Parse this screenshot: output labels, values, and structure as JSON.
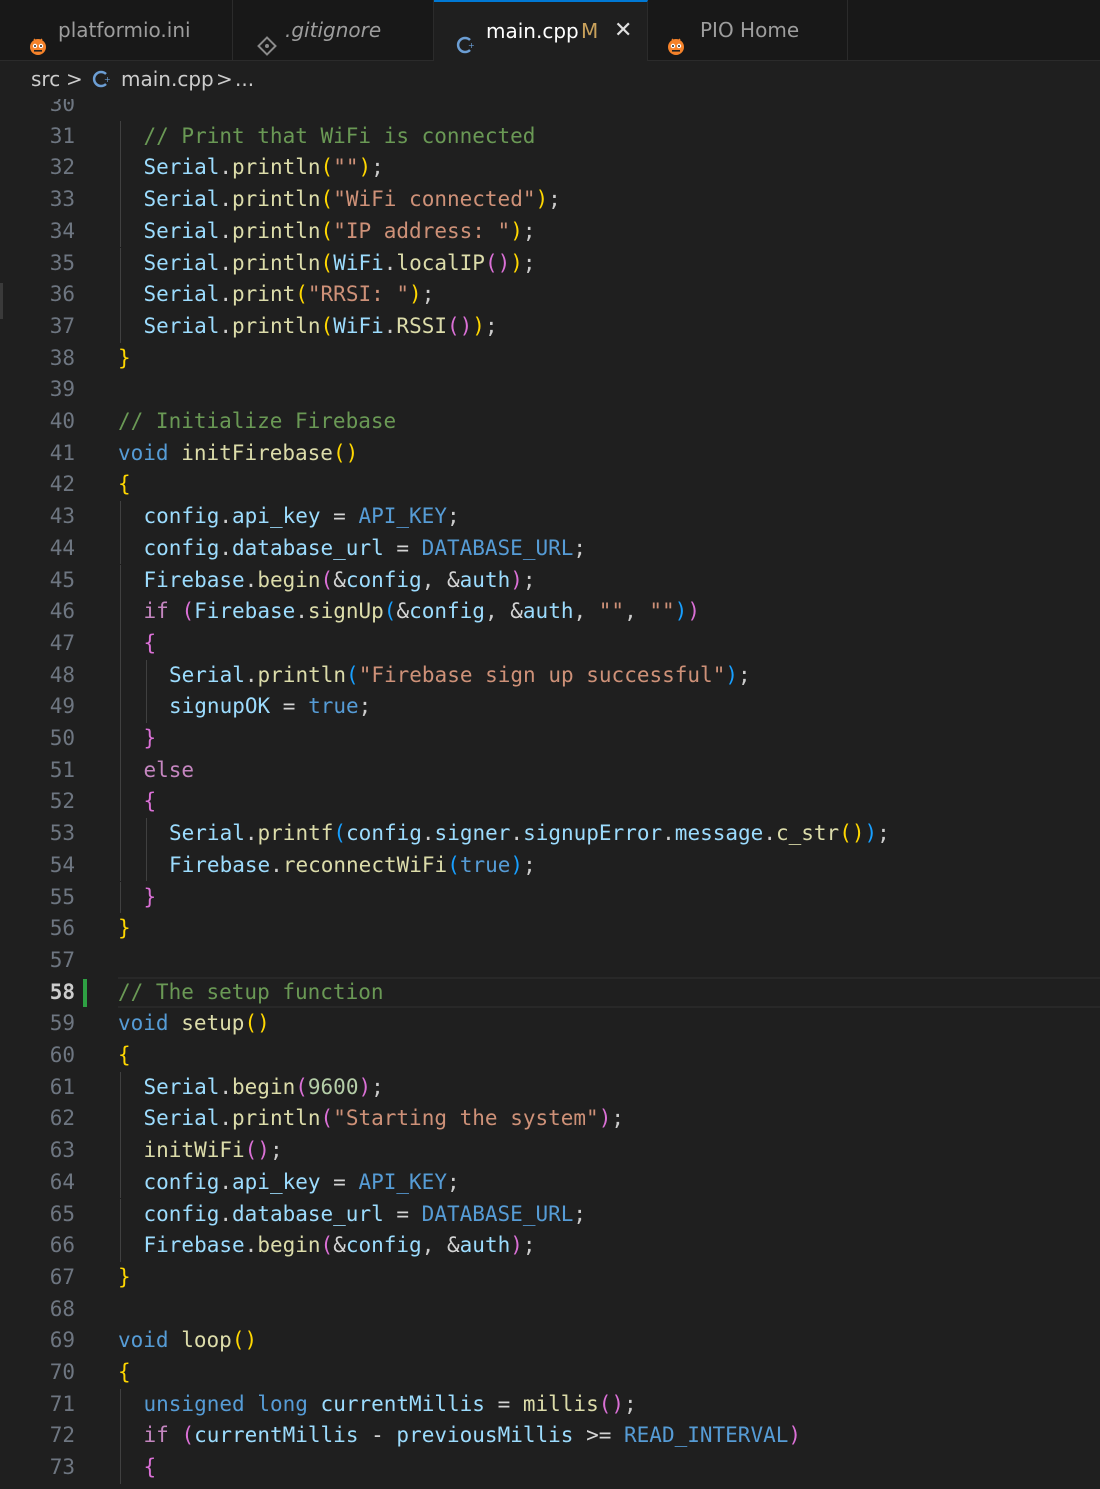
{
  "tabs": [
    {
      "label": "platformio.ini",
      "icon": "platformio-ant-icon"
    },
    {
      "label": ".gitignore",
      "icon": "git-diamond-icon"
    },
    {
      "label": "main.cpp",
      "icon": "cpp-file-icon",
      "modified": "M",
      "close": "✕"
    },
    {
      "label": "PIO Home",
      "icon": "platformio-ant-icon"
    }
  ],
  "breadcrumb": {
    "folder": "src",
    "sep": ">",
    "file": "main.cpp",
    "more": "..."
  },
  "colors": {
    "accent": "#0078d4",
    "git_added": "#2ea043",
    "background": "#1f1f1f"
  },
  "current_line": "58",
  "lines": [
    {
      "n": "30",
      "indent": 0,
      "tokens": []
    },
    {
      "n": "31",
      "indent": 1,
      "tokens": [
        [
          "c-com",
          "// Print that WiFi is connected"
        ]
      ]
    },
    {
      "n": "32",
      "indent": 1,
      "tokens": [
        [
          "c-var",
          "Serial"
        ],
        [
          "c-p",
          "."
        ],
        [
          "c-fn",
          "println"
        ],
        [
          "b1",
          "("
        ],
        [
          "c-str",
          "\"\""
        ],
        [
          "b1",
          ")"
        ],
        [
          "c-p",
          ";"
        ]
      ]
    },
    {
      "n": "33",
      "indent": 1,
      "tokens": [
        [
          "c-var",
          "Serial"
        ],
        [
          "c-p",
          "."
        ],
        [
          "c-fn",
          "println"
        ],
        [
          "b1",
          "("
        ],
        [
          "c-str",
          "\"WiFi connected\""
        ],
        [
          "b1",
          ")"
        ],
        [
          "c-p",
          ";"
        ]
      ]
    },
    {
      "n": "34",
      "indent": 1,
      "tokens": [
        [
          "c-var",
          "Serial"
        ],
        [
          "c-p",
          "."
        ],
        [
          "c-fn",
          "println"
        ],
        [
          "b1",
          "("
        ],
        [
          "c-str",
          "\"IP address: \""
        ],
        [
          "b1",
          ")"
        ],
        [
          "c-p",
          ";"
        ]
      ]
    },
    {
      "n": "35",
      "indent": 1,
      "tokens": [
        [
          "c-var",
          "Serial"
        ],
        [
          "c-p",
          "."
        ],
        [
          "c-fn",
          "println"
        ],
        [
          "b1",
          "("
        ],
        [
          "c-var",
          "WiFi"
        ],
        [
          "c-p",
          "."
        ],
        [
          "c-fn",
          "localIP"
        ],
        [
          "b2",
          "()"
        ],
        [
          "b1",
          ")"
        ],
        [
          "c-p",
          ";"
        ]
      ]
    },
    {
      "n": "36",
      "indent": 1,
      "tokens": [
        [
          "c-var",
          "Serial"
        ],
        [
          "c-p",
          "."
        ],
        [
          "c-fn",
          "print"
        ],
        [
          "b1",
          "("
        ],
        [
          "c-str",
          "\"RRSI: \""
        ],
        [
          "b1",
          ")"
        ],
        [
          "c-p",
          ";"
        ]
      ]
    },
    {
      "n": "37",
      "indent": 1,
      "tokens": [
        [
          "c-var",
          "Serial"
        ],
        [
          "c-p",
          "."
        ],
        [
          "c-fn",
          "println"
        ],
        [
          "b1",
          "("
        ],
        [
          "c-var",
          "WiFi"
        ],
        [
          "c-p",
          "."
        ],
        [
          "c-fn",
          "RSSI"
        ],
        [
          "b2",
          "()"
        ],
        [
          "b1",
          ")"
        ],
        [
          "c-p",
          ";"
        ]
      ]
    },
    {
      "n": "38",
      "indent": 0,
      "tokens": [
        [
          "b1",
          "}"
        ]
      ]
    },
    {
      "n": "39",
      "indent": 0,
      "tokens": []
    },
    {
      "n": "40",
      "indent": 0,
      "tokens": [
        [
          "c-com",
          "// Initialize Firebase"
        ]
      ]
    },
    {
      "n": "41",
      "indent": 0,
      "tokens": [
        [
          "c-kw",
          "void"
        ],
        [
          "c-p",
          " "
        ],
        [
          "c-fn",
          "initFirebase"
        ],
        [
          "b1",
          "()"
        ]
      ]
    },
    {
      "n": "42",
      "indent": 0,
      "tokens": [
        [
          "b1",
          "{"
        ]
      ]
    },
    {
      "n": "43",
      "indent": 1,
      "tokens": [
        [
          "c-var",
          "config"
        ],
        [
          "c-p",
          "."
        ],
        [
          "c-var",
          "api_key"
        ],
        [
          "c-op",
          " = "
        ],
        [
          "c-mac",
          "API_KEY"
        ],
        [
          "c-p",
          ";"
        ]
      ]
    },
    {
      "n": "44",
      "indent": 1,
      "tokens": [
        [
          "c-var",
          "config"
        ],
        [
          "c-p",
          "."
        ],
        [
          "c-var",
          "database_url"
        ],
        [
          "c-op",
          " = "
        ],
        [
          "c-mac",
          "DATABASE_URL"
        ],
        [
          "c-p",
          ";"
        ]
      ]
    },
    {
      "n": "45",
      "indent": 1,
      "tokens": [
        [
          "c-var",
          "Firebase"
        ],
        [
          "c-p",
          "."
        ],
        [
          "c-fn",
          "begin"
        ],
        [
          "b2",
          "("
        ],
        [
          "c-op",
          "&"
        ],
        [
          "c-var",
          "config"
        ],
        [
          "c-p",
          ", "
        ],
        [
          "c-op",
          "&"
        ],
        [
          "c-var",
          "auth"
        ],
        [
          "b2",
          ")"
        ],
        [
          "c-p",
          ";"
        ]
      ]
    },
    {
      "n": "46",
      "indent": 1,
      "tokens": [
        [
          "c-ctl",
          "if"
        ],
        [
          "c-p",
          " "
        ],
        [
          "b2",
          "("
        ],
        [
          "c-var",
          "Firebase"
        ],
        [
          "c-p",
          "."
        ],
        [
          "c-fn",
          "signUp"
        ],
        [
          "b3",
          "("
        ],
        [
          "c-op",
          "&"
        ],
        [
          "c-var",
          "config"
        ],
        [
          "c-p",
          ", "
        ],
        [
          "c-op",
          "&"
        ],
        [
          "c-var",
          "auth"
        ],
        [
          "c-p",
          ", "
        ],
        [
          "c-str",
          "\"\""
        ],
        [
          "c-p",
          ", "
        ],
        [
          "c-str",
          "\"\""
        ],
        [
          "b3",
          ")"
        ],
        [
          "b2",
          ")"
        ]
      ]
    },
    {
      "n": "47",
      "indent": 1,
      "tokens": [
        [
          "b2",
          "{"
        ]
      ]
    },
    {
      "n": "48",
      "indent": 2,
      "tokens": [
        [
          "c-var",
          "Serial"
        ],
        [
          "c-p",
          "."
        ],
        [
          "c-fn",
          "println"
        ],
        [
          "b3",
          "("
        ],
        [
          "c-str",
          "\"Firebase sign up successful\""
        ],
        [
          "b3",
          ")"
        ],
        [
          "c-p",
          ";"
        ]
      ]
    },
    {
      "n": "49",
      "indent": 2,
      "tokens": [
        [
          "c-var",
          "signupOK"
        ],
        [
          "c-op",
          " = "
        ],
        [
          "c-kw",
          "true"
        ],
        [
          "c-p",
          ";"
        ]
      ]
    },
    {
      "n": "50",
      "indent": 1,
      "tokens": [
        [
          "b2",
          "}"
        ]
      ]
    },
    {
      "n": "51",
      "indent": 1,
      "tokens": [
        [
          "c-ctl",
          "else"
        ]
      ]
    },
    {
      "n": "52",
      "indent": 1,
      "tokens": [
        [
          "b2",
          "{"
        ]
      ]
    },
    {
      "n": "53",
      "indent": 2,
      "tokens": [
        [
          "c-var",
          "Serial"
        ],
        [
          "c-p",
          "."
        ],
        [
          "c-fn",
          "printf"
        ],
        [
          "b3",
          "("
        ],
        [
          "c-var",
          "config"
        ],
        [
          "c-p",
          "."
        ],
        [
          "c-var",
          "signer"
        ],
        [
          "c-p",
          "."
        ],
        [
          "c-var",
          "signupError"
        ],
        [
          "c-p",
          "."
        ],
        [
          "c-var",
          "message"
        ],
        [
          "c-p",
          "."
        ],
        [
          "c-fn",
          "c_str"
        ],
        [
          "b1",
          "()"
        ],
        [
          "b3",
          ")"
        ],
        [
          "c-p",
          ";"
        ]
      ]
    },
    {
      "n": "54",
      "indent": 2,
      "tokens": [
        [
          "c-var",
          "Firebase"
        ],
        [
          "c-p",
          "."
        ],
        [
          "c-fn",
          "reconnectWiFi"
        ],
        [
          "b3",
          "("
        ],
        [
          "c-kw",
          "true"
        ],
        [
          "b3",
          ")"
        ],
        [
          "c-p",
          ";"
        ]
      ]
    },
    {
      "n": "55",
      "indent": 1,
      "tokens": [
        [
          "b2",
          "}"
        ]
      ]
    },
    {
      "n": "56",
      "indent": 0,
      "tokens": [
        [
          "b1",
          "}"
        ]
      ]
    },
    {
      "n": "57",
      "indent": 0,
      "tokens": []
    },
    {
      "n": "58",
      "indent": 0,
      "tokens": [
        [
          "c-com",
          "// The setup function"
        ]
      ]
    },
    {
      "n": "59",
      "indent": 0,
      "tokens": [
        [
          "c-kw",
          "void"
        ],
        [
          "c-p",
          " "
        ],
        [
          "c-fn",
          "setup"
        ],
        [
          "b1",
          "()"
        ]
      ]
    },
    {
      "n": "60",
      "indent": 0,
      "tokens": [
        [
          "b1",
          "{"
        ]
      ]
    },
    {
      "n": "61",
      "indent": 1,
      "tokens": [
        [
          "c-var",
          "Serial"
        ],
        [
          "c-p",
          "."
        ],
        [
          "c-fn",
          "begin"
        ],
        [
          "b2",
          "("
        ],
        [
          "c-num",
          "9600"
        ],
        [
          "b2",
          ")"
        ],
        [
          "c-p",
          ";"
        ]
      ]
    },
    {
      "n": "62",
      "indent": 1,
      "tokens": [
        [
          "c-var",
          "Serial"
        ],
        [
          "c-p",
          "."
        ],
        [
          "c-fn",
          "println"
        ],
        [
          "b2",
          "("
        ],
        [
          "c-str",
          "\"Starting the system\""
        ],
        [
          "b2",
          ")"
        ],
        [
          "c-p",
          ";"
        ]
      ]
    },
    {
      "n": "63",
      "indent": 1,
      "tokens": [
        [
          "c-fn",
          "initWiFi"
        ],
        [
          "b2",
          "()"
        ],
        [
          "c-p",
          ";"
        ]
      ]
    },
    {
      "n": "64",
      "indent": 1,
      "tokens": [
        [
          "c-var",
          "config"
        ],
        [
          "c-p",
          "."
        ],
        [
          "c-var",
          "api_key"
        ],
        [
          "c-op",
          " = "
        ],
        [
          "c-mac",
          "API_KEY"
        ],
        [
          "c-p",
          ";"
        ]
      ]
    },
    {
      "n": "65",
      "indent": 1,
      "tokens": [
        [
          "c-var",
          "config"
        ],
        [
          "c-p",
          "."
        ],
        [
          "c-var",
          "database_url"
        ],
        [
          "c-op",
          " = "
        ],
        [
          "c-mac",
          "DATABASE_URL"
        ],
        [
          "c-p",
          ";"
        ]
      ]
    },
    {
      "n": "66",
      "indent": 1,
      "tokens": [
        [
          "c-var",
          "Firebase"
        ],
        [
          "c-p",
          "."
        ],
        [
          "c-fn",
          "begin"
        ],
        [
          "b2",
          "("
        ],
        [
          "c-op",
          "&"
        ],
        [
          "c-var",
          "config"
        ],
        [
          "c-p",
          ", "
        ],
        [
          "c-op",
          "&"
        ],
        [
          "c-var",
          "auth"
        ],
        [
          "b2",
          ")"
        ],
        [
          "c-p",
          ";"
        ]
      ]
    },
    {
      "n": "67",
      "indent": 0,
      "tokens": [
        [
          "b1",
          "}"
        ]
      ]
    },
    {
      "n": "68",
      "indent": 0,
      "tokens": []
    },
    {
      "n": "69",
      "indent": 0,
      "tokens": [
        [
          "c-kw",
          "void"
        ],
        [
          "c-p",
          " "
        ],
        [
          "c-fn",
          "loop"
        ],
        [
          "b1",
          "()"
        ]
      ]
    },
    {
      "n": "70",
      "indent": 0,
      "tokens": [
        [
          "b1",
          "{"
        ]
      ]
    },
    {
      "n": "71",
      "indent": 1,
      "tokens": [
        [
          "c-kw",
          "unsigned"
        ],
        [
          "c-p",
          " "
        ],
        [
          "c-kw",
          "long"
        ],
        [
          "c-p",
          " "
        ],
        [
          "c-var",
          "currentMillis"
        ],
        [
          "c-op",
          " = "
        ],
        [
          "c-fn",
          "millis"
        ],
        [
          "b2",
          "()"
        ],
        [
          "c-p",
          ";"
        ]
      ]
    },
    {
      "n": "72",
      "indent": 1,
      "tokens": [
        [
          "c-ctl",
          "if"
        ],
        [
          "c-p",
          " "
        ],
        [
          "b2",
          "("
        ],
        [
          "c-var",
          "currentMillis"
        ],
        [
          "c-op",
          " - "
        ],
        [
          "c-var",
          "previousMillis"
        ],
        [
          "c-op",
          " >= "
        ],
        [
          "c-mac",
          "READ_INTERVAL"
        ],
        [
          "b2",
          ")"
        ]
      ]
    },
    {
      "n": "73",
      "indent": 1,
      "tokens": [
        [
          "b2",
          "{"
        ]
      ]
    }
  ]
}
